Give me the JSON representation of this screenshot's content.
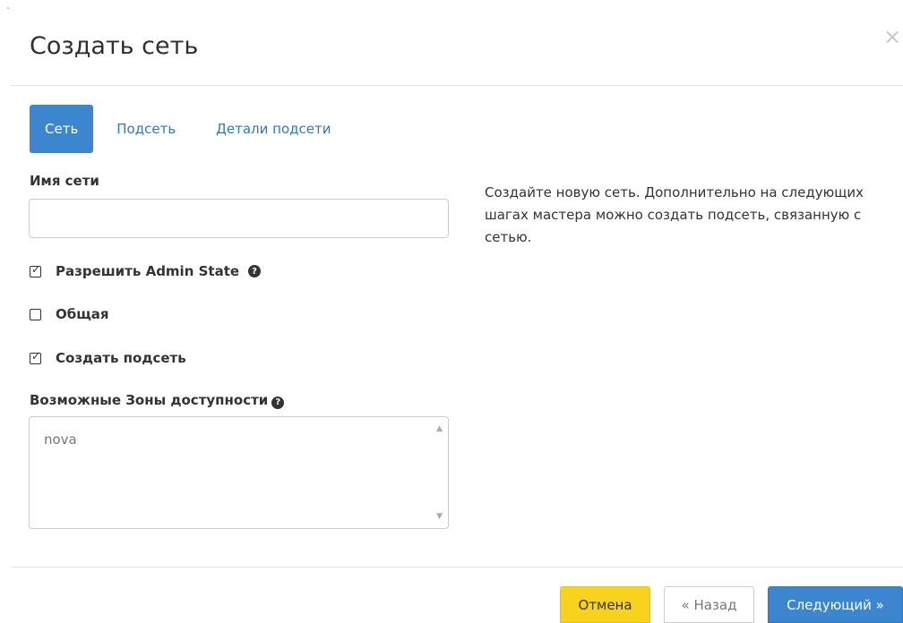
{
  "dialog": {
    "title": "Создать сеть",
    "close_icon": "×"
  },
  "tabs": [
    {
      "label": "Сеть",
      "active": true
    },
    {
      "label": "Подсеть",
      "active": false
    },
    {
      "label": "Детали подсети",
      "active": false
    }
  ],
  "form": {
    "network_name": {
      "label": "Имя сети",
      "value": "",
      "placeholder": ""
    },
    "admin_state": {
      "label": "Разрешить Admin State",
      "checked": true,
      "help_icon": "?"
    },
    "shared": {
      "label": "Общая",
      "checked": false
    },
    "create_subnet": {
      "label": "Создать подсеть",
      "checked": true
    },
    "availability_zones": {
      "label": "Возможные Зоны доступности",
      "help_icon": "?",
      "options": [
        "nova"
      ]
    }
  },
  "description": "Создайте новую сеть. Дополнительно на следующих шагах мастера можно создать подсеть, связанную с сетью.",
  "footer": {
    "cancel_label": "Отмена",
    "back_label": "« Назад",
    "next_label": "Следующий »"
  },
  "colors": {
    "primary": "#3b86cf",
    "link": "#2a7ac8",
    "cancel": "#f7d31e"
  }
}
